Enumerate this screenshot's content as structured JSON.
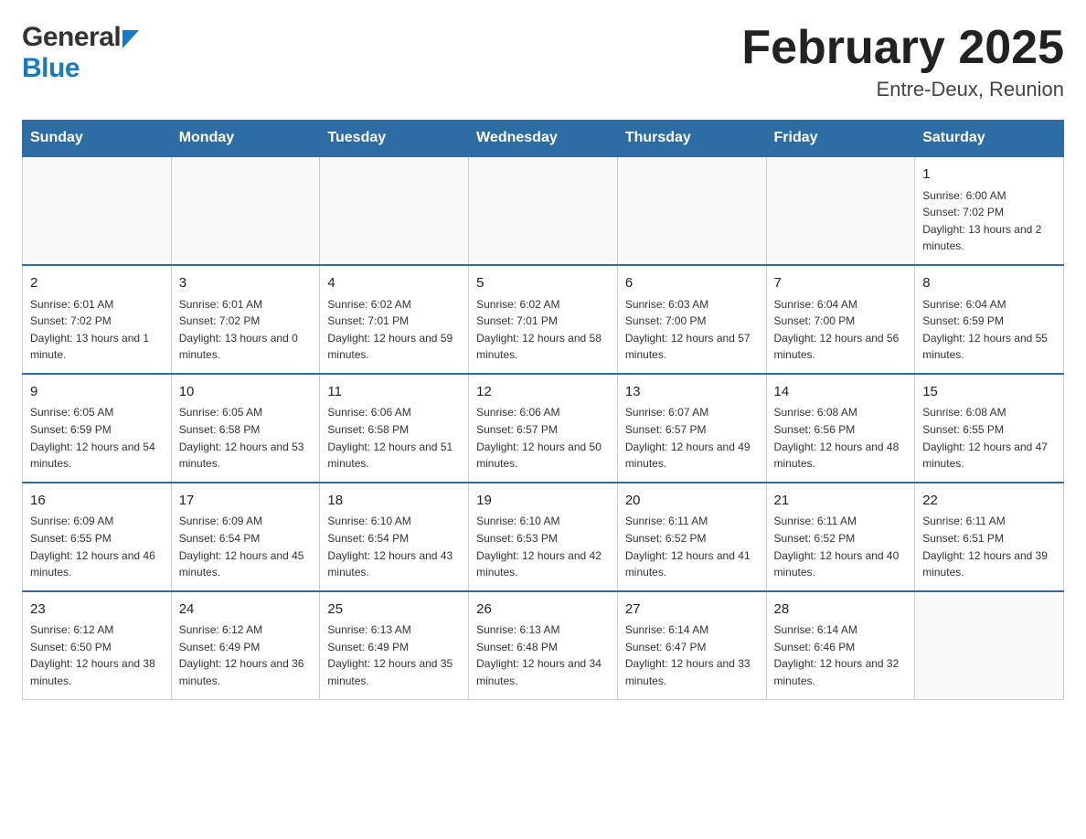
{
  "header": {
    "logo_general": "General",
    "logo_blue": "Blue",
    "month_title": "February 2025",
    "location": "Entre-Deux, Reunion"
  },
  "days_of_week": [
    "Sunday",
    "Monday",
    "Tuesday",
    "Wednesday",
    "Thursday",
    "Friday",
    "Saturday"
  ],
  "weeks": [
    {
      "days": [
        {
          "number": "",
          "info": "",
          "empty": true
        },
        {
          "number": "",
          "info": "",
          "empty": true
        },
        {
          "number": "",
          "info": "",
          "empty": true
        },
        {
          "number": "",
          "info": "",
          "empty": true
        },
        {
          "number": "",
          "info": "",
          "empty": true
        },
        {
          "number": "",
          "info": "",
          "empty": true
        },
        {
          "number": "1",
          "info": "Sunrise: 6:00 AM\nSunset: 7:02 PM\nDaylight: 13 hours and 2 minutes.",
          "empty": false
        }
      ]
    },
    {
      "days": [
        {
          "number": "2",
          "info": "Sunrise: 6:01 AM\nSunset: 7:02 PM\nDaylight: 13 hours and 1 minute.",
          "empty": false
        },
        {
          "number": "3",
          "info": "Sunrise: 6:01 AM\nSunset: 7:02 PM\nDaylight: 13 hours and 0 minutes.",
          "empty": false
        },
        {
          "number": "4",
          "info": "Sunrise: 6:02 AM\nSunset: 7:01 PM\nDaylight: 12 hours and 59 minutes.",
          "empty": false
        },
        {
          "number": "5",
          "info": "Sunrise: 6:02 AM\nSunset: 7:01 PM\nDaylight: 12 hours and 58 minutes.",
          "empty": false
        },
        {
          "number": "6",
          "info": "Sunrise: 6:03 AM\nSunset: 7:00 PM\nDaylight: 12 hours and 57 minutes.",
          "empty": false
        },
        {
          "number": "7",
          "info": "Sunrise: 6:04 AM\nSunset: 7:00 PM\nDaylight: 12 hours and 56 minutes.",
          "empty": false
        },
        {
          "number": "8",
          "info": "Sunrise: 6:04 AM\nSunset: 6:59 PM\nDaylight: 12 hours and 55 minutes.",
          "empty": false
        }
      ]
    },
    {
      "days": [
        {
          "number": "9",
          "info": "Sunrise: 6:05 AM\nSunset: 6:59 PM\nDaylight: 12 hours and 54 minutes.",
          "empty": false
        },
        {
          "number": "10",
          "info": "Sunrise: 6:05 AM\nSunset: 6:58 PM\nDaylight: 12 hours and 53 minutes.",
          "empty": false
        },
        {
          "number": "11",
          "info": "Sunrise: 6:06 AM\nSunset: 6:58 PM\nDaylight: 12 hours and 51 minutes.",
          "empty": false
        },
        {
          "number": "12",
          "info": "Sunrise: 6:06 AM\nSunset: 6:57 PM\nDaylight: 12 hours and 50 minutes.",
          "empty": false
        },
        {
          "number": "13",
          "info": "Sunrise: 6:07 AM\nSunset: 6:57 PM\nDaylight: 12 hours and 49 minutes.",
          "empty": false
        },
        {
          "number": "14",
          "info": "Sunrise: 6:08 AM\nSunset: 6:56 PM\nDaylight: 12 hours and 48 minutes.",
          "empty": false
        },
        {
          "number": "15",
          "info": "Sunrise: 6:08 AM\nSunset: 6:55 PM\nDaylight: 12 hours and 47 minutes.",
          "empty": false
        }
      ]
    },
    {
      "days": [
        {
          "number": "16",
          "info": "Sunrise: 6:09 AM\nSunset: 6:55 PM\nDaylight: 12 hours and 46 minutes.",
          "empty": false
        },
        {
          "number": "17",
          "info": "Sunrise: 6:09 AM\nSunset: 6:54 PM\nDaylight: 12 hours and 45 minutes.",
          "empty": false
        },
        {
          "number": "18",
          "info": "Sunrise: 6:10 AM\nSunset: 6:54 PM\nDaylight: 12 hours and 43 minutes.",
          "empty": false
        },
        {
          "number": "19",
          "info": "Sunrise: 6:10 AM\nSunset: 6:53 PM\nDaylight: 12 hours and 42 minutes.",
          "empty": false
        },
        {
          "number": "20",
          "info": "Sunrise: 6:11 AM\nSunset: 6:52 PM\nDaylight: 12 hours and 41 minutes.",
          "empty": false
        },
        {
          "number": "21",
          "info": "Sunrise: 6:11 AM\nSunset: 6:52 PM\nDaylight: 12 hours and 40 minutes.",
          "empty": false
        },
        {
          "number": "22",
          "info": "Sunrise: 6:11 AM\nSunset: 6:51 PM\nDaylight: 12 hours and 39 minutes.",
          "empty": false
        }
      ]
    },
    {
      "days": [
        {
          "number": "23",
          "info": "Sunrise: 6:12 AM\nSunset: 6:50 PM\nDaylight: 12 hours and 38 minutes.",
          "empty": false
        },
        {
          "number": "24",
          "info": "Sunrise: 6:12 AM\nSunset: 6:49 PM\nDaylight: 12 hours and 36 minutes.",
          "empty": false
        },
        {
          "number": "25",
          "info": "Sunrise: 6:13 AM\nSunset: 6:49 PM\nDaylight: 12 hours and 35 minutes.",
          "empty": false
        },
        {
          "number": "26",
          "info": "Sunrise: 6:13 AM\nSunset: 6:48 PM\nDaylight: 12 hours and 34 minutes.",
          "empty": false
        },
        {
          "number": "27",
          "info": "Sunrise: 6:14 AM\nSunset: 6:47 PM\nDaylight: 12 hours and 33 minutes.",
          "empty": false
        },
        {
          "number": "28",
          "info": "Sunrise: 6:14 AM\nSunset: 6:46 PM\nDaylight: 12 hours and 32 minutes.",
          "empty": false
        },
        {
          "number": "",
          "info": "",
          "empty": true
        }
      ]
    }
  ]
}
